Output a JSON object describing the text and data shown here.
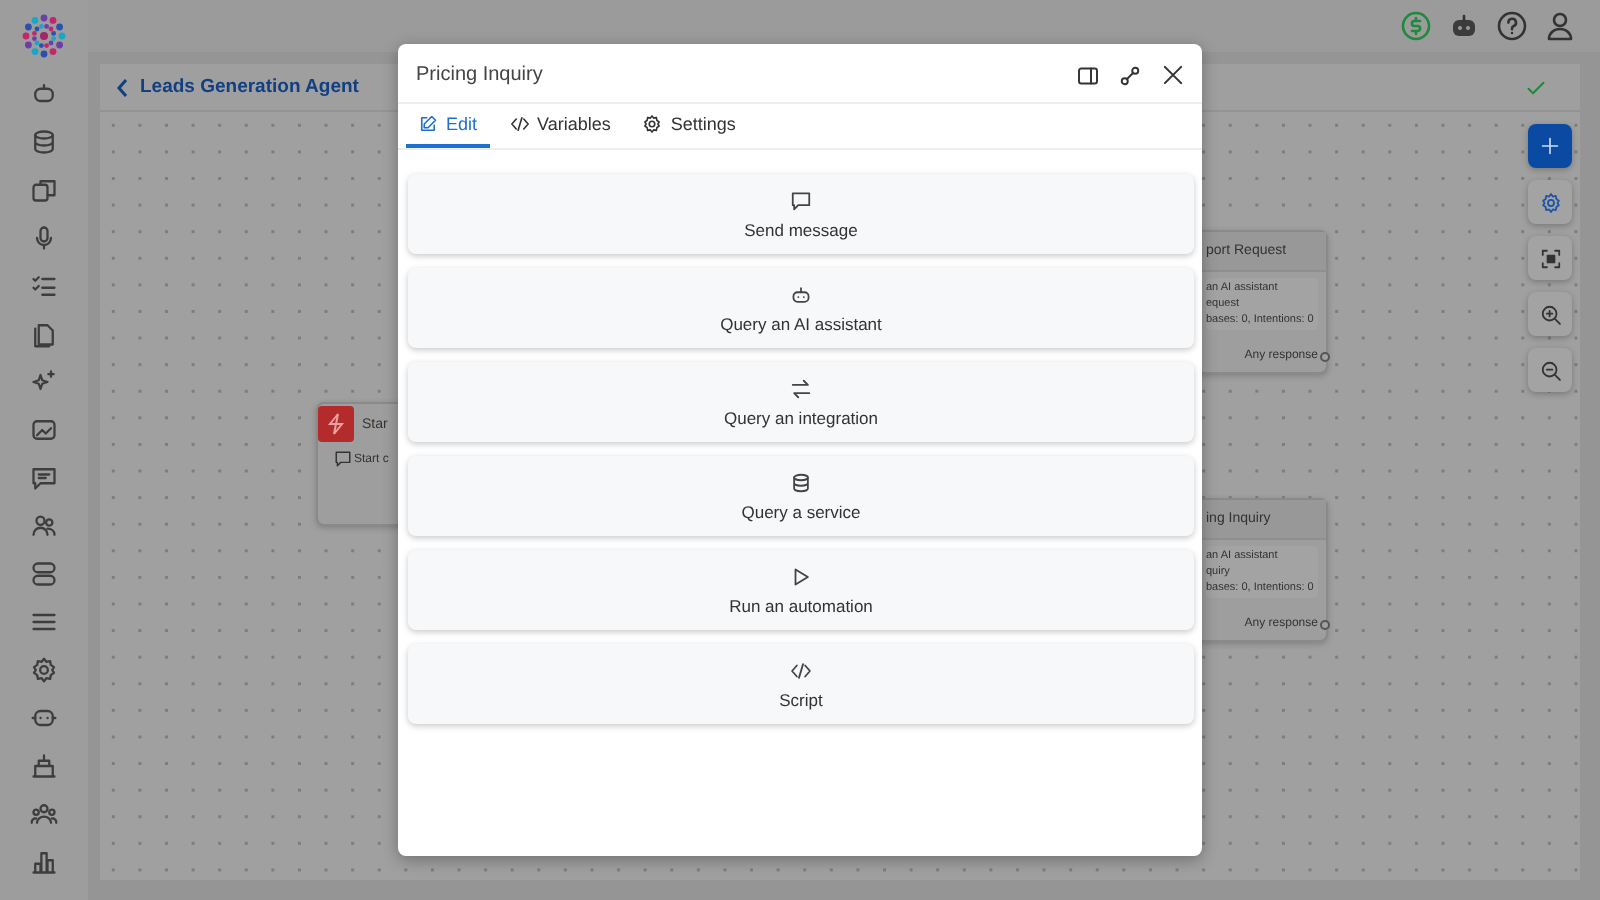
{
  "breadcrumb": {
    "label": "Leads Generation Agent"
  },
  "nodes": [
    {
      "kind": "start",
      "title": "Star",
      "lines": [
        "Start c"
      ]
    },
    {
      "kind": "step",
      "title": "port Request",
      "lines": [
        "an AI assistant",
        "equest",
        "bases: 0, Intentions: 0"
      ],
      "output": "Any response"
    },
    {
      "kind": "step",
      "title": "ing Inquiry",
      "lines": [
        "an AI assistant",
        "quiry",
        "bases: 0, Intentions: 0"
      ],
      "output": "Any response"
    }
  ],
  "dialog": {
    "title": "Pricing Inquiry",
    "tabs": [
      {
        "kind": "edit",
        "label": "Edit",
        "selected": true
      },
      {
        "kind": "code",
        "label": "Variables",
        "selected": false
      },
      {
        "kind": "gear",
        "label": "Settings",
        "selected": false
      }
    ],
    "actions": [
      {
        "kind": "message",
        "label": "Send message"
      },
      {
        "kind": "assistant",
        "label": "Query an AI assistant"
      },
      {
        "kind": "integration",
        "label": "Query an integration"
      },
      {
        "kind": "service",
        "label": "Query a service"
      },
      {
        "kind": "automation",
        "label": "Run an automation"
      },
      {
        "kind": "script",
        "label": "Script"
      }
    ]
  }
}
